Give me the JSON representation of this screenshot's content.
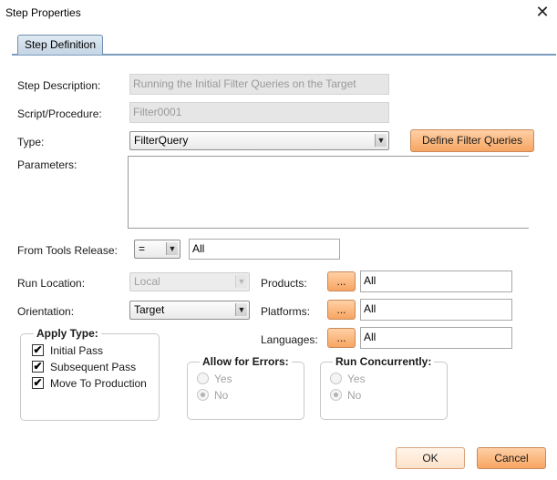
{
  "window": {
    "title": "Step Properties",
    "close_glyph": "✕"
  },
  "tabs": [
    {
      "label": "Step Definition"
    }
  ],
  "step_description": {
    "label": "Step Description:",
    "value": "Running the Initial Filter Queries on the Target"
  },
  "script_procedure": {
    "label": "Script/Procedure:",
    "value": "Filter0001"
  },
  "type": {
    "label": "Type:",
    "selected": "FilterQuery",
    "define_button": "Define Filter Queries"
  },
  "parameters": {
    "label": "Parameters:"
  },
  "from_tools_release": {
    "label": "From Tools Release:",
    "operator": "=",
    "value": "All"
  },
  "run_location": {
    "label": "Run Location:",
    "selected": "Local"
  },
  "orientation": {
    "label": "Orientation:",
    "selected": "Target"
  },
  "products": {
    "label": "Products:",
    "button": "...",
    "value": "All"
  },
  "platforms": {
    "label": "Platforms:",
    "button": "...",
    "value": "All"
  },
  "languages": {
    "label": "Languages:",
    "button": "...",
    "value": "All"
  },
  "apply_type": {
    "title": "Apply Type:",
    "options": [
      {
        "label": "Initial Pass",
        "checked": true
      },
      {
        "label": "Subsequent Pass",
        "checked": true
      },
      {
        "label": "Move To Production",
        "checked": true
      }
    ]
  },
  "allow_for_errors": {
    "title": "Allow for Errors:",
    "options": [
      {
        "label": "Yes",
        "selected": false
      },
      {
        "label": "No",
        "selected": true
      }
    ]
  },
  "run_concurrently": {
    "title": "Run Concurrently:",
    "options": [
      {
        "label": "Yes",
        "selected": false
      },
      {
        "label": "No",
        "selected": true
      }
    ]
  },
  "buttons": {
    "ok": "OK",
    "cancel": "Cancel"
  },
  "check_glyph": "✔",
  "dropdown_glyph": "▼",
  "colors": {
    "accent_button": "#f7a561",
    "tab": "#c5d5e4",
    "tab_border": "#7a9cbd"
  }
}
